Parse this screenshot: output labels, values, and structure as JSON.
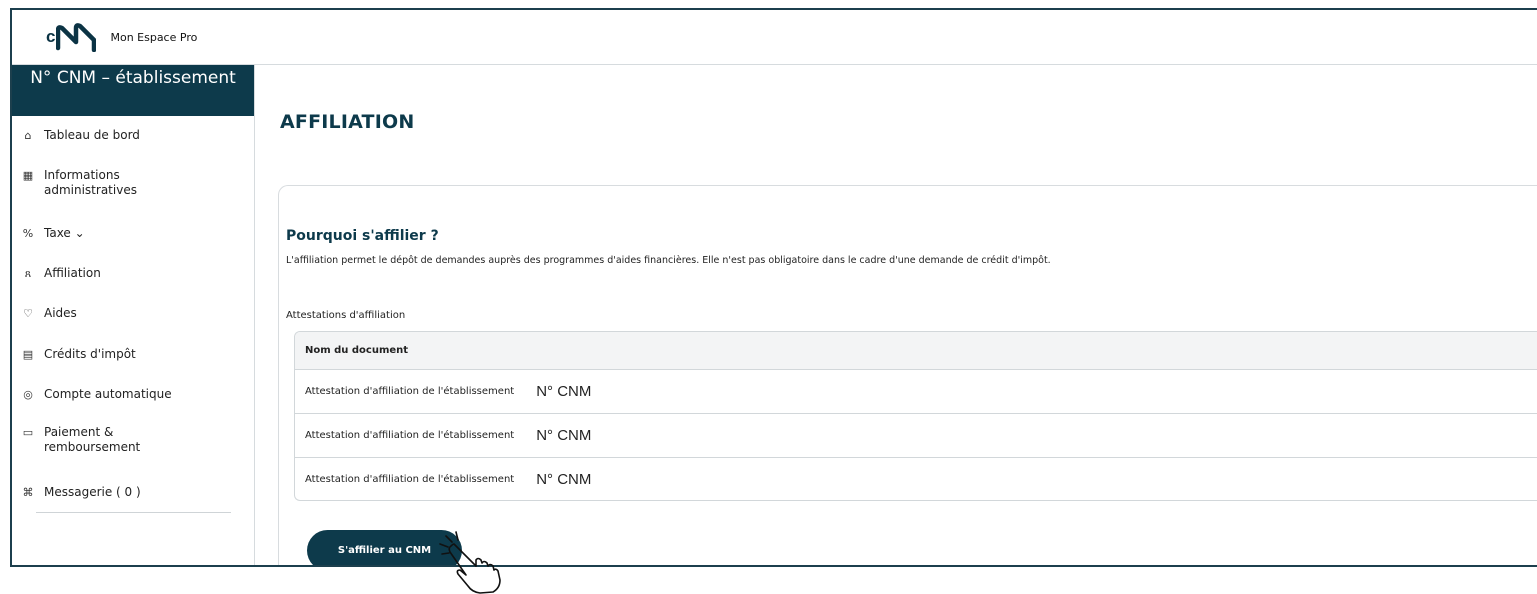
{
  "app": {
    "title": "Mon Espace Pro",
    "logo_text": "cNM"
  },
  "sidebar": {
    "banner": "N° CNM – établissement",
    "items": [
      {
        "label": "Tableau de bord",
        "icon": "home-icon",
        "glyph": "⌂"
      },
      {
        "label": "Informations administratives",
        "icon": "building-icon",
        "glyph": "▦"
      },
      {
        "label": "Taxe ⌄",
        "icon": "percent-icon",
        "glyph": "%"
      },
      {
        "label": "Affiliation",
        "icon": "users-icon",
        "glyph": "ጸ"
      },
      {
        "label": "Aides",
        "icon": "lightbulb-icon",
        "glyph": "♡"
      },
      {
        "label": "Crédits d'impôt",
        "icon": "receipt-icon",
        "glyph": "▤"
      },
      {
        "label": "Compte automatique",
        "icon": "target-icon",
        "glyph": "◎"
      },
      {
        "label": "Paiement & remboursement",
        "icon": "wallet-icon",
        "glyph": "▭"
      },
      {
        "label": "Messagerie ( 0 )",
        "icon": "message-icon",
        "glyph": "⌘"
      }
    ]
  },
  "main": {
    "page_title": "AFFILIATION",
    "section_title": "Pourquoi s'affilier ?",
    "section_text": "L'affiliation permet le dépôt de demandes auprès des programmes d'aides financières. Elle n'est pas obligatoire dans le cadre d'une demande de crédit d'impôt.",
    "table_caption": "Attestations d'affiliation",
    "table": {
      "header": "Nom du document",
      "rows": [
        {
          "doc": "Attestation d'affiliation de l'établissement",
          "number": "N° CNM"
        },
        {
          "doc": "Attestation d'affiliation de l'établissement",
          "number": "N° CNM"
        },
        {
          "doc": "Attestation d'affiliation de l'établissement",
          "number": "N° CNM"
        }
      ]
    },
    "button_label": "S'affilier au CNM"
  }
}
